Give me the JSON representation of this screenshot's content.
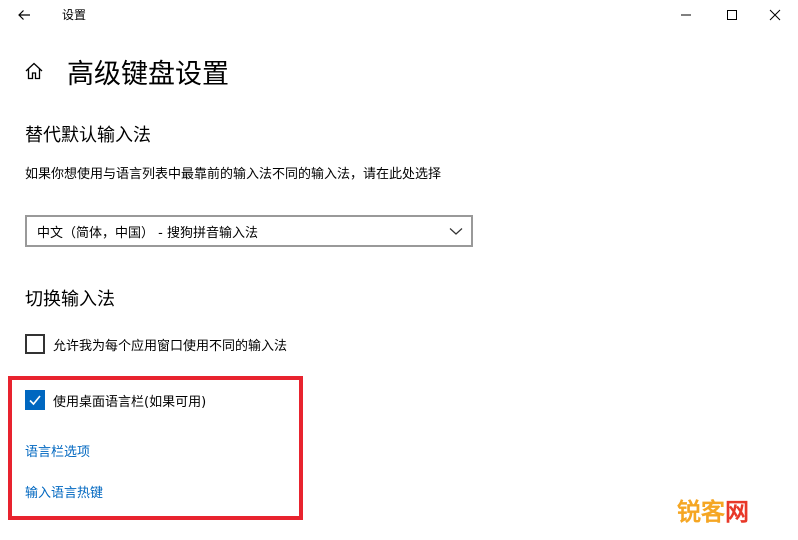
{
  "window": {
    "title": "设置",
    "controls": [
      "minimize-icon",
      "maximize-icon",
      "close-icon"
    ]
  },
  "page": {
    "title": "高级键盘设置"
  },
  "sections": {
    "override_input": {
      "title": "替代默认输入法",
      "description": "如果你想使用与语言列表中最靠前的输入法不同的输入法，请在此处选择",
      "dropdown_value": "中文（简体，中国） - 搜狗拼音输入法"
    },
    "switch_input": {
      "title": "切换输入法",
      "checkbox_per_app": {
        "label": "允许我为每个应用窗口使用不同的输入法",
        "checked": false
      },
      "checkbox_language_bar": {
        "label": "使用桌面语言栏(如果可用)",
        "checked": true
      },
      "link_language_bar_options": "语言栏选项",
      "link_input_hotkeys": "输入语言热键"
    }
  },
  "annotation": {
    "highlight_color": "#e8232e"
  },
  "watermark": {
    "part1": "锐客",
    "part2": "网"
  },
  "colors": {
    "accent": "#0067c0",
    "link": "#0067c0",
    "highlight": "#e8232e"
  }
}
